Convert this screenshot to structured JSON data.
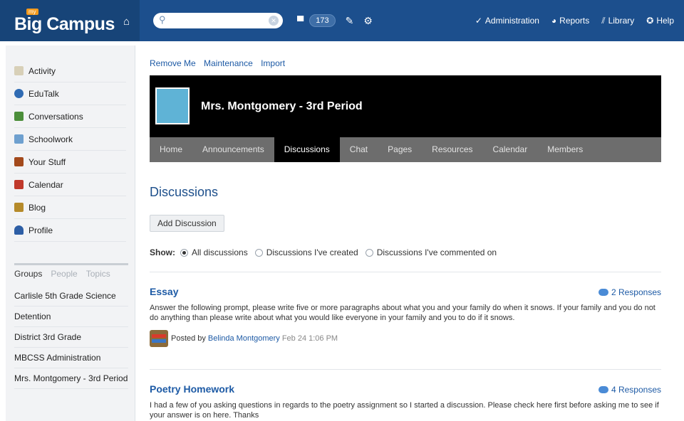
{
  "app": {
    "logo_tag": "my",
    "logo_text": "Big Campus"
  },
  "topbar": {
    "search": {
      "placeholder": ""
    },
    "message_count": "173",
    "nav": [
      {
        "label": "Administration",
        "icon": "wrench-icon"
      },
      {
        "label": "Reports",
        "icon": "pie-chart-icon"
      },
      {
        "label": "Library",
        "icon": "library-icon"
      },
      {
        "label": "Help",
        "icon": "help-icon"
      }
    ]
  },
  "sidebar": {
    "items": [
      {
        "label": "Activity",
        "icon": "activity-icon",
        "color": "#d8d0b8"
      },
      {
        "label": "EduTalk",
        "icon": "edutalk-icon",
        "color": "#2f6bb3"
      },
      {
        "label": "Conversations",
        "icon": "conversations-icon",
        "color": "#4b8e3a"
      },
      {
        "label": "Schoolwork",
        "icon": "schoolwork-icon",
        "color": "#6ea0cf"
      },
      {
        "label": "Your Stuff",
        "icon": "your-stuff-icon",
        "color": "#a34a1c"
      },
      {
        "label": "Calendar",
        "icon": "calendar-icon",
        "color": "#c0392b"
      },
      {
        "label": "Blog",
        "icon": "blog-icon",
        "color": "#b58a2a"
      },
      {
        "label": "Profile",
        "icon": "profile-icon",
        "color": "#2d5ea5"
      }
    ],
    "tabs": [
      "Groups",
      "People",
      "Topics"
    ],
    "groups": [
      "Carlisle 5th Grade Science",
      "Detention",
      "District 3rd Grade",
      "MBCSS Administration",
      "Mrs. Montgomery - 3rd Period"
    ]
  },
  "main": {
    "links": [
      "Remove Me",
      "Maintenance",
      "Import"
    ],
    "group_title": "Mrs. Montgomery - 3rd Period",
    "tabs": [
      "Home",
      "Announcements",
      "Discussions",
      "Chat",
      "Pages",
      "Resources",
      "Calendar",
      "Members"
    ],
    "active_tab": "Discussions",
    "page_title": "Discussions",
    "add_button": "Add Discussion",
    "show": {
      "label": "Show:",
      "options": [
        "All discussions",
        "Discussions I've created",
        "Discussions I've commented on"
      ],
      "selected": "All discussions"
    },
    "posts": [
      {
        "title": "Essay",
        "responses": "2 Responses",
        "body": "Answer the following prompt, please write five or more paragraphs about what you and your family do when it snows. If your family and you do not do anything than please write about what you would like everyone in your family and you to do if it snows.",
        "posted_by": "Posted by",
        "author": "Belinda Montgomery",
        "date": "Feb 24 1:06 PM"
      },
      {
        "title": "Poetry Homework",
        "responses": "4 Responses",
        "body": "I had a few of you asking questions in regards to the poetry assignment so I started a discussion. Please check here first before asking me to see if your answer is on here. Thanks"
      }
    ]
  }
}
